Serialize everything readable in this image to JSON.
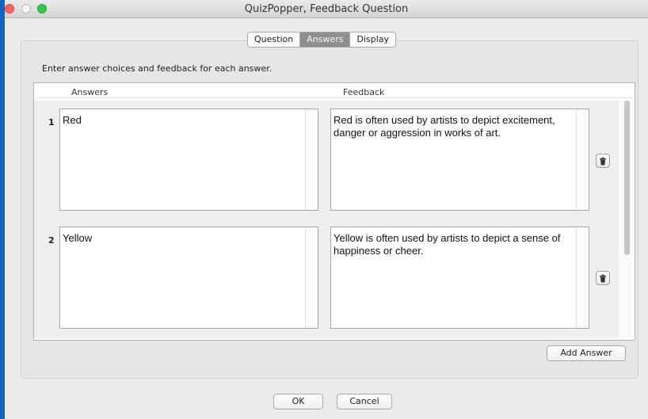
{
  "window": {
    "title": "QuizPopper, Feedback Question"
  },
  "tabs": [
    {
      "label": "Question",
      "active": false
    },
    {
      "label": "Answers",
      "active": true
    },
    {
      "label": "Display",
      "active": false
    }
  ],
  "instructions": "Enter answer choices and feedback for each answer.",
  "columns": {
    "answers": "Answers",
    "feedback": "Feedback"
  },
  "rows": [
    {
      "number": "1",
      "answer": "Red",
      "feedback": "Red is often used by artists to depict excitement, danger or aggression in works of art."
    },
    {
      "number": "2",
      "answer": "Yellow",
      "feedback": "Yellow is often used by artists to depict a sense of happiness or cheer."
    }
  ],
  "buttons": {
    "add_answer": "Add Answer",
    "ok": "OK",
    "cancel": "Cancel"
  },
  "icons": {
    "delete_row": "trash-icon"
  },
  "colors": {
    "active_tab": "#8f8f8f",
    "close": "#fc605c",
    "zoom": "#34c84a"
  }
}
